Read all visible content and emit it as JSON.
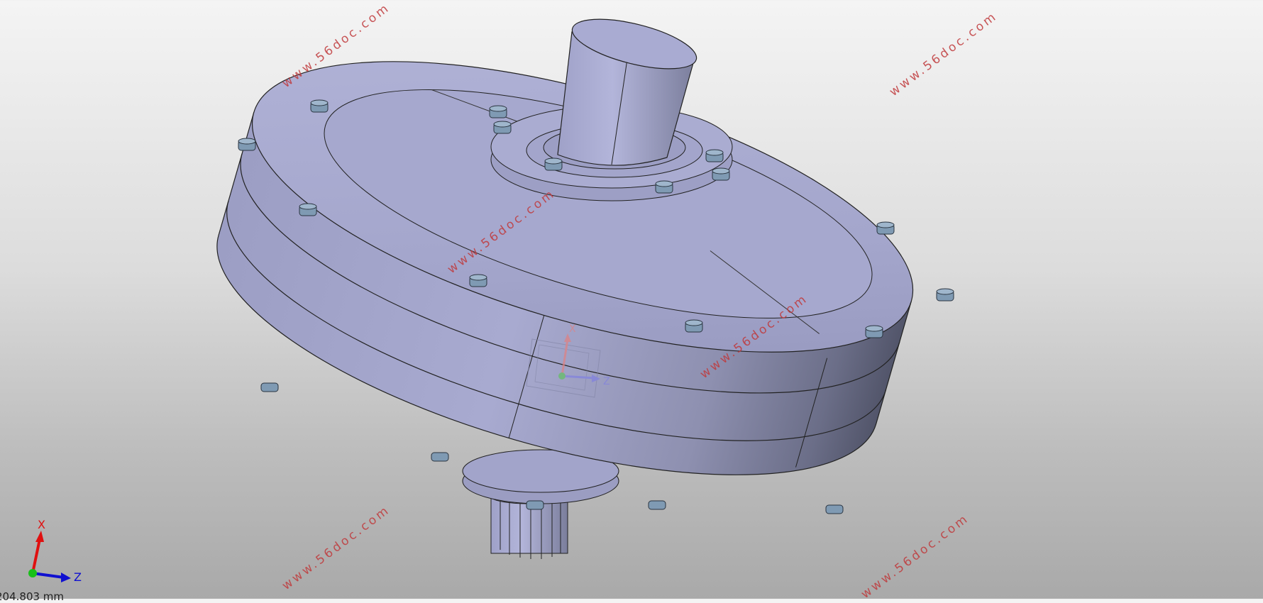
{
  "watermark": "www.56doc.com",
  "triad": {
    "x_label": "X",
    "z_label": "Z"
  },
  "center_triad": {
    "x_label": "X",
    "z_label": "Z"
  },
  "scale_readout": "204.803 mm",
  "colors": {
    "part_face": "#a3a5c9",
    "part_shadow": "#54586f",
    "bolt": "#7f9ab3",
    "watermark": "#c0393b",
    "axis_x": "#e01010",
    "axis_z": "#1010d0",
    "axis_origin": "#19c019"
  }
}
